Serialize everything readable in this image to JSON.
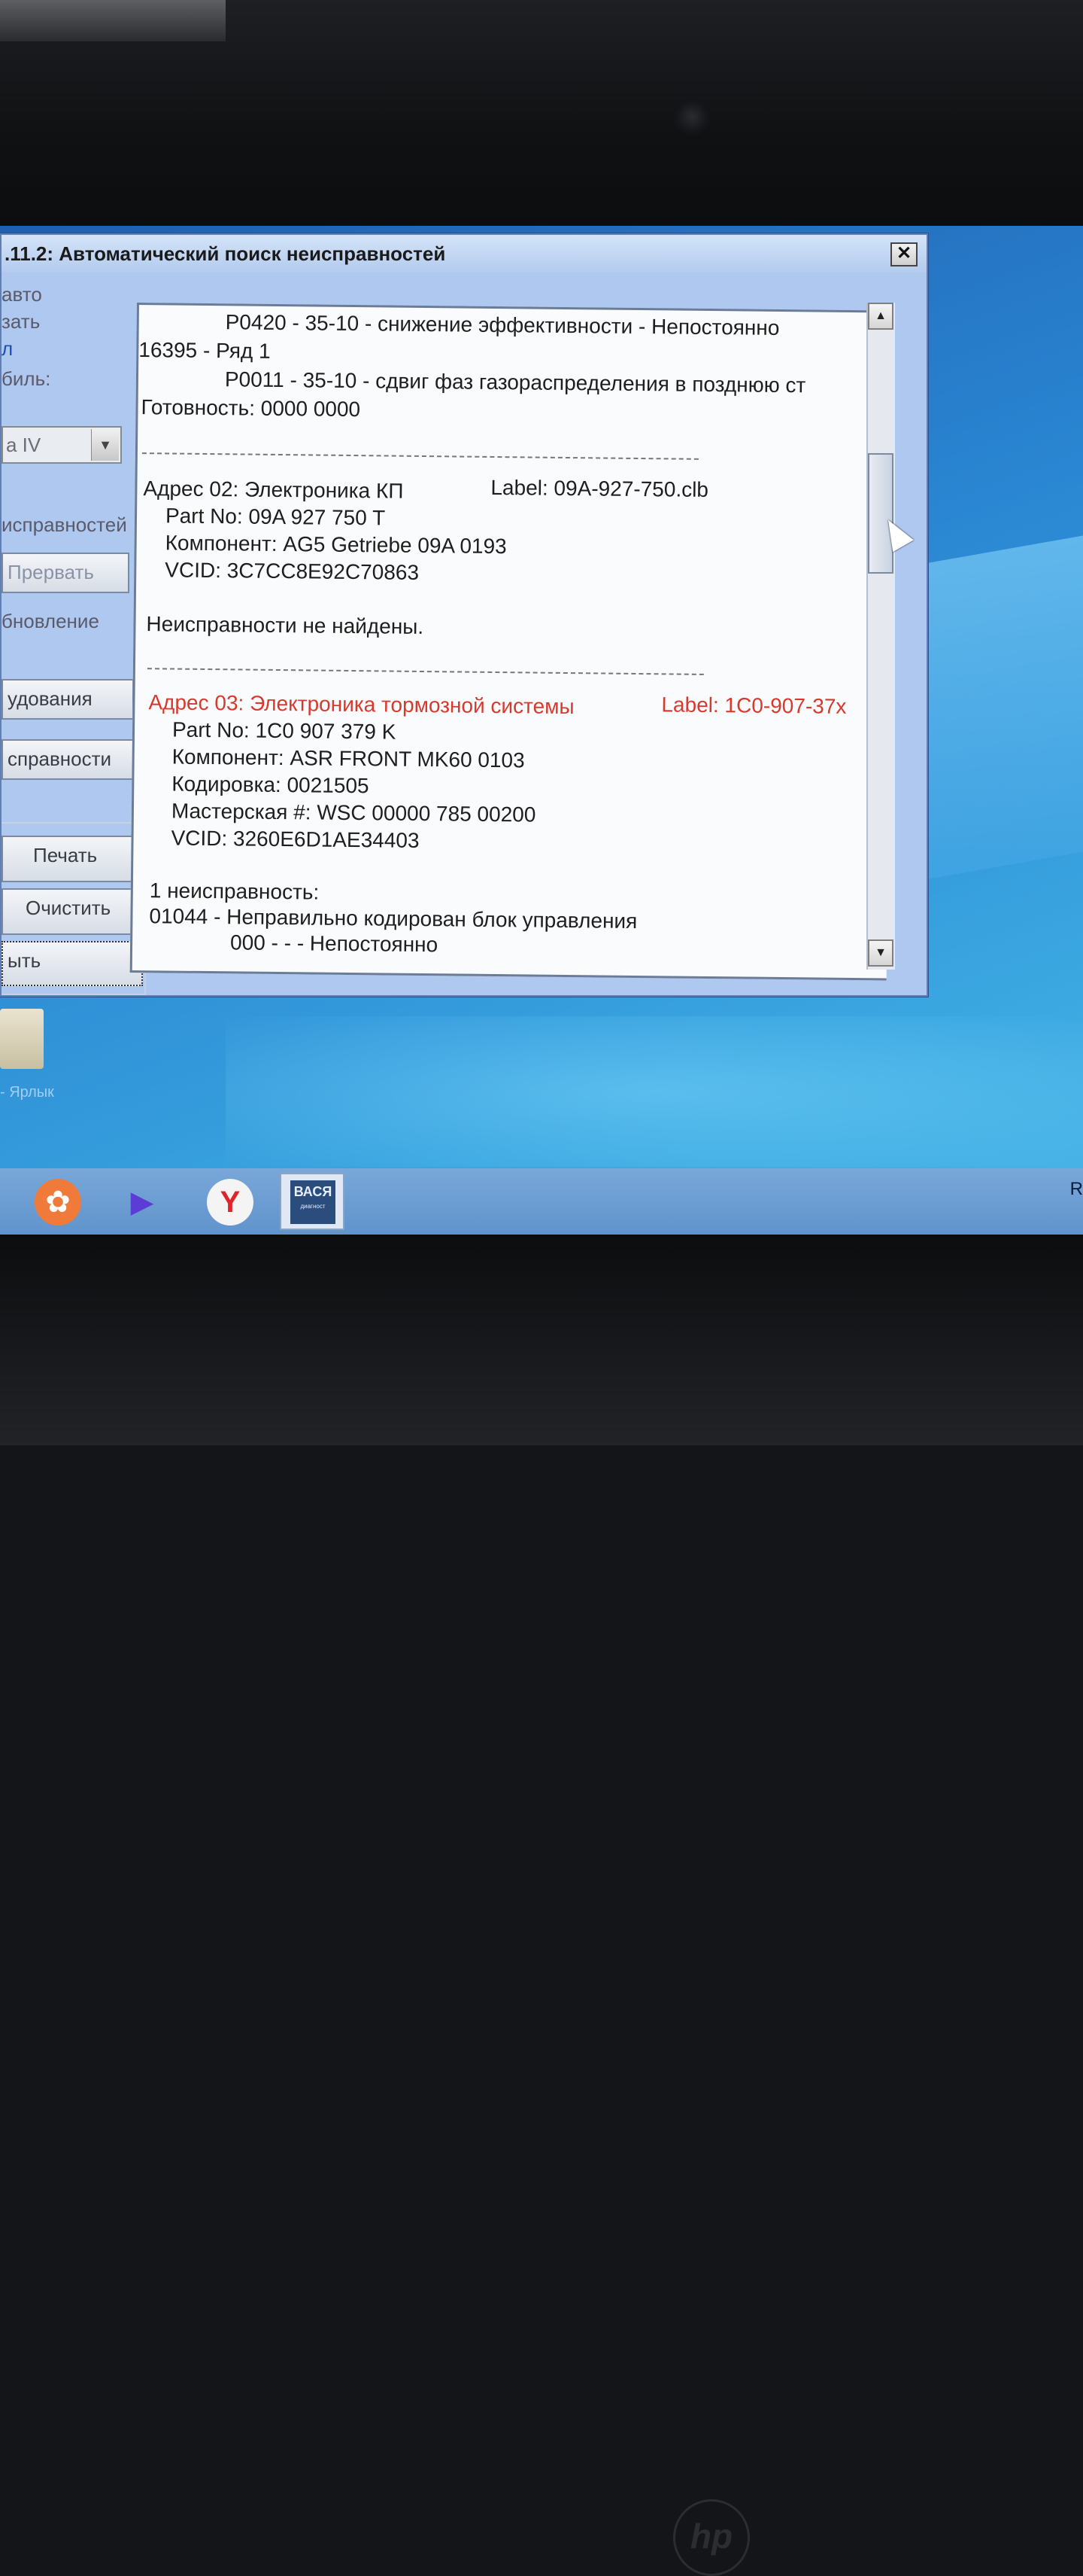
{
  "window": {
    "title": ".11.2: Автоматический поиск неисправностей",
    "close_label": "✕"
  },
  "left_panel": {
    "label_auto": "авто",
    "label_save": "зать",
    "link_text": "л",
    "label_car": "биль:",
    "combo_value": "а IV",
    "label_faults": "исправностей",
    "btn_abort": "Прервать",
    "label_update": "бновление",
    "btn_equipment": "удования",
    "btn_faults": "справности",
    "btn_print": "Печать",
    "btn_clear": "Очистить",
    "btn_close": "ыть"
  },
  "report": {
    "l1": "P0420 - 35-10 - снижение эффективности - Непостоянно",
    "l2": "16395 - Ряд 1",
    "l3": "P0011 - 35-10 - сдвиг фаз газораспределения в позднюю ст",
    "l4": "Готовность: 0000 0000",
    "m2_address": "Адрес 02:   Электроника КП",
    "m2_label": "Label: 09A-927-750.clb",
    "m2_part": "Part No: 09A 927 750 T",
    "m2_component": "Компонент: AG5 Getriebe 09A   0193",
    "m2_vcid": "VCID: 3C7CC8E92C70863",
    "m2_status": "Неисправности не найдены.",
    "m3_address": "Адрес 03:  Электроника тормозной системы",
    "m3_label": "Label: 1C0-907-37x",
    "m3_part": "Part No: 1C0 907 379 K",
    "m3_component": "Компонент: ASR FRONT MK60       0103",
    "m3_coding": "Кодировка: 0021505",
    "m3_workshop": "Мастерская #: WSC 00000 785 00200",
    "m3_vcid": "VCID: 3260E6D1AE34403",
    "m3_count": "1 неисправность:",
    "m3_fault": "01044 - Неправильно кодирован блок управления",
    "m3_fault_detail": "000 -  -  - Непостоянно"
  },
  "scrollbar": {
    "up": "▲",
    "down": "▼"
  },
  "desktop": {
    "shortcut_label": "- Ярлык"
  },
  "taskbar": {
    "app_vasya": "ВАСЯ",
    "app_vasya_sub": "диагност",
    "right_text": "R"
  },
  "laptop": {
    "brand": "hp"
  },
  "colors": {
    "fault_header": "#d63a2e",
    "window_bg": "#aec8ef",
    "desktop": "#2a86d2"
  }
}
